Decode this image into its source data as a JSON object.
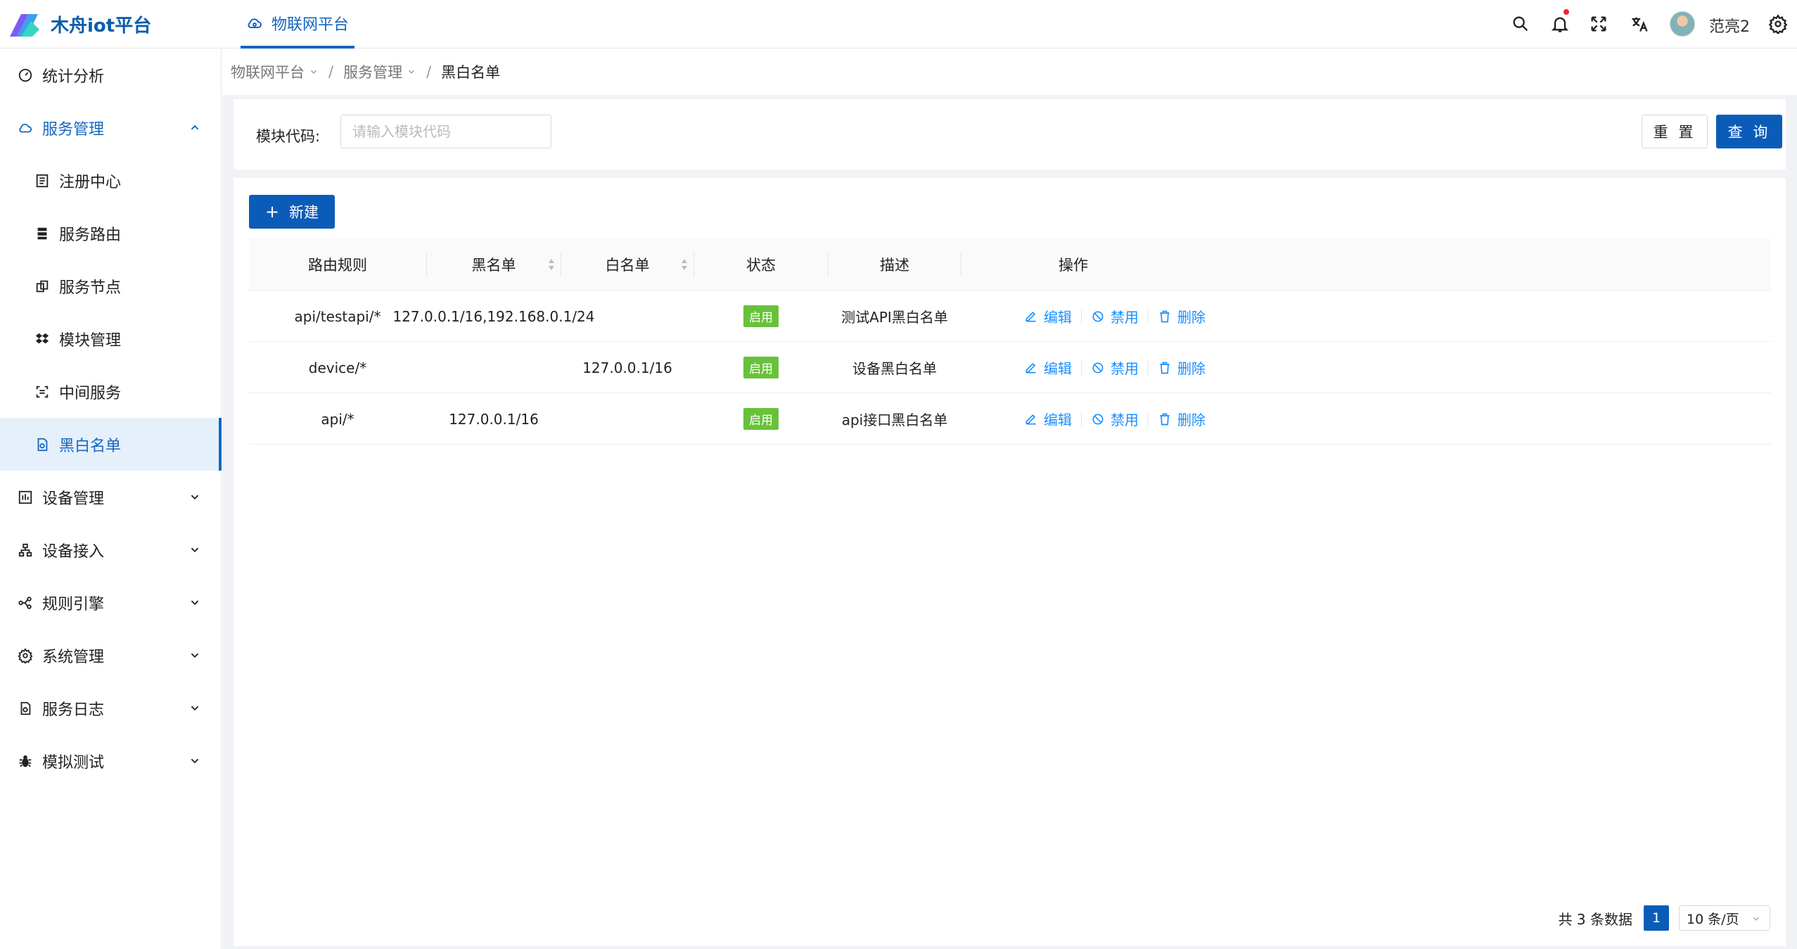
{
  "app": {
    "title": "木舟iot平台",
    "top_tab": "物联网平台",
    "username": "范亮2",
    "brand_color": "#1565c0",
    "accent_color": "#0b5cb8",
    "notification_dot": true
  },
  "header_icons": [
    "search-icon",
    "bell-icon",
    "fullscreen-icon",
    "translate-icon",
    "gear-icon"
  ],
  "sidebar": {
    "items": [
      {
        "label": "统计分析",
        "icon": "dashboard-icon",
        "level": 0
      },
      {
        "label": "服务管理",
        "icon": "cloud-icon",
        "level": 0,
        "expanded": true
      },
      {
        "label": "注册中心",
        "icon": "list-icon",
        "level": 1
      },
      {
        "label": "服务路由",
        "icon": "server-icon",
        "level": 1
      },
      {
        "label": "服务节点",
        "icon": "nodes-icon",
        "level": 1
      },
      {
        "label": "模块管理",
        "icon": "dropbox-icon",
        "level": 1
      },
      {
        "label": "中间服务",
        "icon": "middleware-icon",
        "level": 1
      },
      {
        "label": "黑白名单",
        "icon": "file-icon",
        "level": 1,
        "active": true
      },
      {
        "label": "设备管理",
        "icon": "device-icon",
        "level": 0
      },
      {
        "label": "设备接入",
        "icon": "network-icon",
        "level": 0
      },
      {
        "label": "规则引擎",
        "icon": "share-icon",
        "level": 0
      },
      {
        "label": "系统管理",
        "icon": "settings-icon",
        "level": 0
      },
      {
        "label": "服务日志",
        "icon": "log-icon",
        "level": 0
      },
      {
        "label": "模拟测试",
        "icon": "bug-icon",
        "level": 0
      }
    ]
  },
  "breadcrumb": {
    "items": [
      "物联网平台",
      "服务管理"
    ],
    "current": "黑白名单"
  },
  "search": {
    "label": "模块代码:",
    "placeholder": "请输入模块代码",
    "value": "",
    "reset_label": "重 置",
    "query_label": "查 询"
  },
  "toolbar": {
    "new_label": "新建"
  },
  "table": {
    "columns": [
      "路由规则",
      "黑名单",
      "白名单",
      "状态",
      "描述",
      "操作"
    ],
    "rows": [
      {
        "route": "api/testapi/*",
        "blacklist": "127.0.0.1/16,192.168.0.1/24",
        "whitelist": "",
        "status": "启用",
        "desc": "测试API黑白名单"
      },
      {
        "route": "device/*",
        "blacklist": "",
        "whitelist": "127.0.0.1/16",
        "status": "启用",
        "desc": "设备黑白名单"
      },
      {
        "route": "api/*",
        "blacklist": "127.0.0.1/16",
        "whitelist": "",
        "status": "启用",
        "desc": "api接口黑白名单"
      }
    ],
    "actions": {
      "edit": "编辑",
      "disable": "禁用",
      "delete": "删除"
    },
    "status_color": "#67c23a"
  },
  "pagination": {
    "total_text": "共 3 条数据",
    "current_page": "1",
    "page_size": "10 条/页"
  }
}
